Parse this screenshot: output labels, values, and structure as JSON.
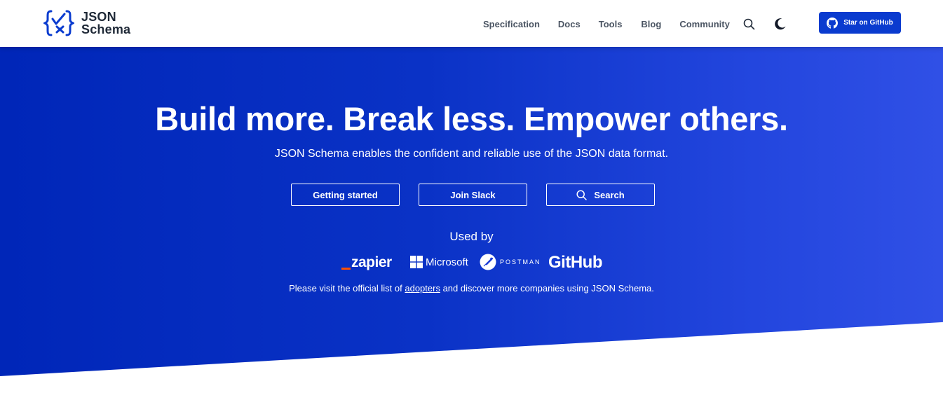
{
  "header": {
    "logo": {
      "line1": "JSON",
      "line2": "Schema",
      "icon": "json-schema-logo-icon"
    },
    "nav": {
      "specification": "Specification",
      "docs": "Docs",
      "tools": "Tools",
      "blog": "Blog",
      "community": "Community"
    },
    "search_icon": "search-icon",
    "theme_icon": "moon-icon",
    "github_button": "Star on GitHub"
  },
  "hero": {
    "title": "Build more. Break less. Empower others.",
    "subtitle": "JSON Schema enables the confident and reliable use of the JSON data format.",
    "buttons": {
      "getting_started": "Getting started",
      "join_slack": "Join Slack",
      "search": "Search"
    },
    "used_by": "Used by",
    "logos": {
      "zapier": "zapier",
      "microsoft": "Microsoft",
      "postman": "POSTMAN",
      "github": "GitHub"
    },
    "adopters": {
      "before": "Please visit the official list of ",
      "link": "adopters",
      "after": " and discover more companies using JSON Schema."
    }
  },
  "colors": {
    "brand_blue": "#0a3bcf",
    "hero_start": "#0026b8",
    "hero_end": "#3050e6",
    "zapier_orange": "#ff4f00"
  }
}
